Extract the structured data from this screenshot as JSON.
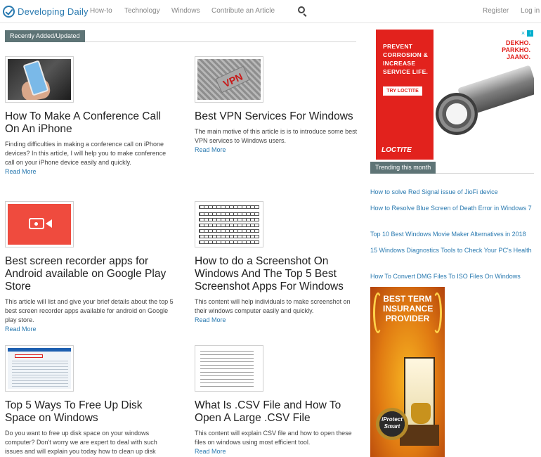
{
  "header": {
    "logo_text": "Developing Daily",
    "nav": [
      "How-to",
      "Technology",
      "Windows",
      "Contribute an Article"
    ],
    "register": "Register",
    "login": "Log in"
  },
  "section": {
    "title": "Recently Added/Updated"
  },
  "articles": [
    {
      "title": "How To Make A Conference Call On An iPhone",
      "desc": "Finding difficulties in making a conference call on iPhone devices? In this article, I will help you to make conference call on your iPhone device easily and quickly.",
      "read_more": "Read More"
    },
    {
      "title": "Best VPN Services For Windows",
      "desc": "The main motive of this article is is to introduce some best VPN services to Windows users.",
      "read_more": "Read More",
      "thumb_text": "VPN"
    },
    {
      "title": "Best screen recorder apps for Android available on Google Play Store",
      "desc": "This article will list and give your brief details about the top 5 best screen recorder apps available for android on Google play store.",
      "read_more": "Read More"
    },
    {
      "title": "How to do a Screenshot On Windows And The Top 5 Best Screenshot Apps For Windows",
      "desc": "This content will help individuals to make screenshot on their windows computer easily and quickly.",
      "read_more": "Read More"
    },
    {
      "title": "Top 5 Ways To Free Up Disk Space on Windows",
      "desc": "Do you want to free up disk space on your windows computer? Don't worry we are expert to deal with such issues and will explain you today how to clean up disk",
      "read_more": ""
    },
    {
      "title": "What Is .CSV File and How To Open A Large .CSV File",
      "desc": "This content will explain CSV file and how to open these files on windows using most efficient tool.",
      "read_more": "Read More"
    }
  ],
  "ad1": {
    "copy": "PREVENT CORROSION & INCREASE SERVICE LIFE.",
    "button": "TRY LOCTITE",
    "brand": "LOCTITE",
    "tagline": "DEKHO. PARKHO. JAANO."
  },
  "trending": {
    "title": "Trending this month",
    "items": [
      "How to solve Red Signal issue of JioFi device",
      "How to Resolve Blue Screen of Death Error in Windows 7",
      "Top 10 Best Windows Movie Maker Alternatives in 2018",
      "15 Windows Diagnostics Tools to Check Your PC's Health",
      "How To Convert DMG Files To ISO Files On Windows"
    ]
  },
  "ad2": {
    "headline": "BEST TERM INSURANCE PROVIDER",
    "badge": "iProtect Smart"
  },
  "colors": {
    "accent": "#2a7ab0",
    "tag_bg": "#5e7476",
    "ad_red": "#e2221d"
  }
}
